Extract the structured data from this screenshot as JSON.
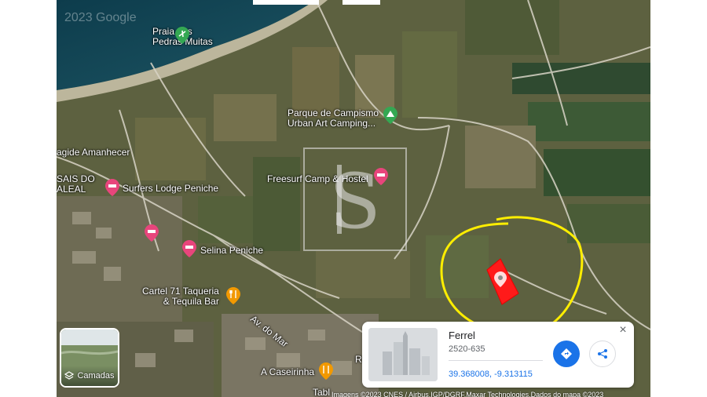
{
  "map": {
    "google_logo": "2023 Google",
    "places": [
      {
        "id": "praia",
        "label_lines": [
          "Praia das",
          "Pedras Muitas"
        ],
        "icon": "beach-pin-icon",
        "color": "#34a853"
      },
      {
        "id": "parque",
        "label_lines": [
          "Parque de Campismo",
          "Urban Art Camping..."
        ],
        "icon": "camping-pin-icon",
        "color": "#34a853"
      },
      {
        "id": "amanhecer",
        "label_lines": [
          "agide Amanhecer"
        ],
        "icon": "",
        "color": ""
      },
      {
        "id": "baleal",
        "label_lines": [
          "SAIS DO",
          "ALEAL"
        ],
        "icon": "",
        "color": ""
      },
      {
        "id": "surfers",
        "label_lines": [
          "Surfers Lodge Peniche"
        ],
        "icon": "hotel-pin-icon",
        "color": "#e8457c"
      },
      {
        "id": "freesurf",
        "label_lines": [
          "Freesurf Camp & Hostel"
        ],
        "icon": "hotel-pin-icon",
        "color": "#e8457c"
      },
      {
        "id": "selina",
        "label_lines": [
          "Selina Peniche"
        ],
        "icon": "hotel-pin-icon",
        "color": "#e8457c"
      },
      {
        "id": "hotel-unnamed",
        "label_lines": [],
        "icon": "hotel-pin-icon",
        "color": "#e8457c"
      },
      {
        "id": "cartel",
        "label_lines": [
          "Cartel 71 Taqueria",
          "& Tequila Bar"
        ],
        "icon": "restaurant-pin-icon",
        "color": "#f29900"
      },
      {
        "id": "caseirinha",
        "label_lines": [
          "A Caseirinha"
        ],
        "icon": "restaurant-pin-icon",
        "color": "#f29900"
      },
      {
        "id": "road",
        "label_lines": [
          "Av. do Mar"
        ],
        "icon": "",
        "color": ""
      },
      {
        "id": "tabl",
        "label_lines": [
          "Tabl"
        ],
        "icon": "",
        "color": ""
      },
      {
        "id": "r",
        "label_lines": [
          "R"
        ],
        "icon": "",
        "color": ""
      }
    ],
    "selected_plot_color": "#ff1a1a",
    "highlight_circle_color": "#ffee00"
  },
  "layers_button": {
    "label": "Camadas"
  },
  "place_card": {
    "name": "Ferrel",
    "postal": "2520-635",
    "coordinates": "39.368008, -9.313115",
    "close_symbol": "×"
  },
  "attribution": "Imagens ©2023 CNES / Airbus,IGP/DGRF,Maxar Technologies,Dados do mapa ©2023"
}
